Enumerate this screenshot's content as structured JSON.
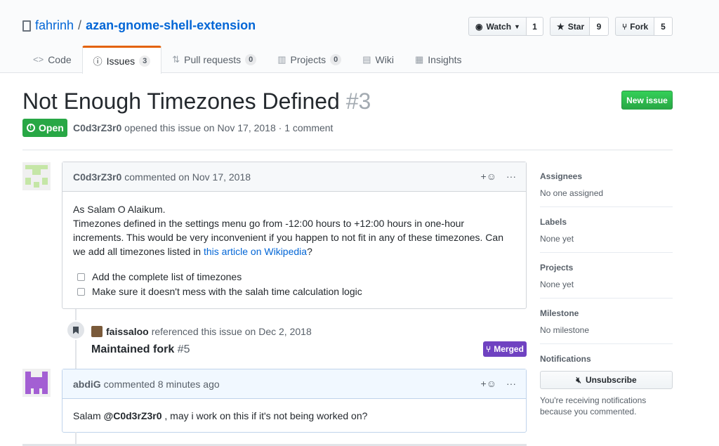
{
  "repo": {
    "owner": "fahrinh",
    "separator": "/",
    "name": "azan-gnome-shell-extension"
  },
  "actions": {
    "watch_label": "Watch",
    "watch_count": "1",
    "star_label": "Star",
    "star_count": "9",
    "fork_label": "Fork",
    "fork_count": "5"
  },
  "tabs": [
    {
      "label": "Code",
      "icon": "code-icon"
    },
    {
      "label": "Issues",
      "count": "3",
      "icon": "issue-icon"
    },
    {
      "label": "Pull requests",
      "count": "0",
      "icon": "pull-request-icon"
    },
    {
      "label": "Projects",
      "count": "0",
      "icon": "project-icon"
    },
    {
      "label": "Wiki",
      "icon": "book-icon"
    },
    {
      "label": "Insights",
      "icon": "graph-icon"
    }
  ],
  "issue": {
    "title": "Not Enough Timezones Defined",
    "number": "#3",
    "state": "Open",
    "author": "C0d3rZ3r0",
    "meta": "opened this issue on Nov 17, 2018 · 1 comment",
    "new_issue_label": "New issue"
  },
  "comment1": {
    "author": "C0d3rZ3r0",
    "meta": "commented on Nov 17, 2018",
    "line1": "As Salam O Alaikum.",
    "line2": "Timezones defined in the settings menu go from -12:00 hours to +12:00 hours in one-hour increments. This would be very inconvenient if you happen to not fit in any of these timezones. Can we add all timezones listed in ",
    "link": "this article on Wikipedia",
    "line2_end": "?",
    "tasks": [
      "Add the complete list of timezones",
      "Make sure it doesn't mess with the salah time calculation logic"
    ]
  },
  "reference": {
    "author": "faissaloo",
    "meta": "referenced this issue on Dec 2, 2018",
    "title": "Maintained fork",
    "number": "#5",
    "badge": "Merged"
  },
  "comment2": {
    "author": "abdiG",
    "meta": "commented 8 minutes ago",
    "body_pre": "Salam ",
    "mention": "@C0d3rZ3r0",
    "body_post": " , may i work on this if it's not being worked on?"
  },
  "sidebar": {
    "assignees_h": "Assignees",
    "assignees_v": "No one assigned",
    "labels_h": "Labels",
    "labels_v": "None yet",
    "projects_h": "Projects",
    "projects_v": "None yet",
    "milestone_h": "Milestone",
    "milestone_v": "No milestone",
    "notifications_h": "Notifications",
    "unsubscribe_label": "Unsubscribe",
    "notif_text": "You're receiving notifications because you commented."
  },
  "colors": {
    "accent": "#0366d6",
    "open": "#28a745",
    "merged": "#6f42c1",
    "tab_highlight": "#e36209"
  }
}
